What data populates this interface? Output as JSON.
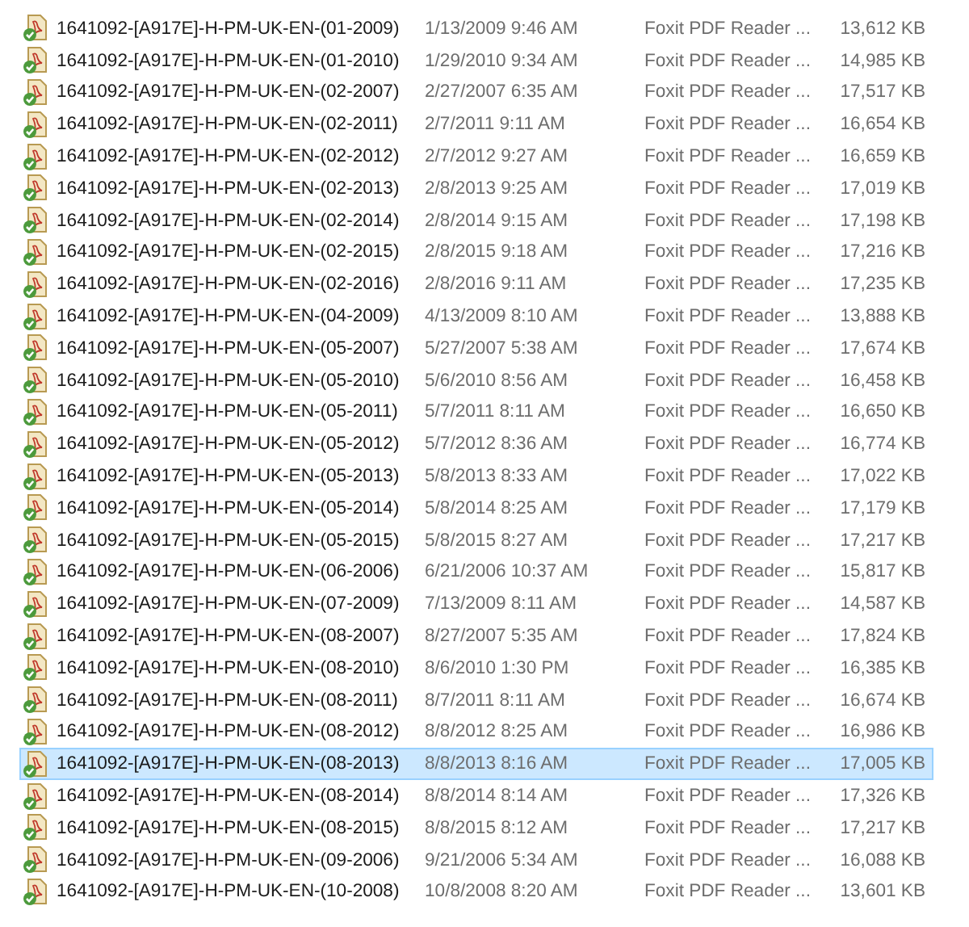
{
  "files": [
    {
      "name": "1641092-[A917E]-H-PM-UK-EN-(01-2009)",
      "date": "1/13/2009 9:46 AM",
      "type": "Foxit PDF Reader ...",
      "size": "13,612 KB",
      "selected": false
    },
    {
      "name": "1641092-[A917E]-H-PM-UK-EN-(01-2010)",
      "date": "1/29/2010 9:34 AM",
      "type": "Foxit PDF Reader ...",
      "size": "14,985 KB",
      "selected": false
    },
    {
      "name": "1641092-[A917E]-H-PM-UK-EN-(02-2007)",
      "date": "2/27/2007 6:35 AM",
      "type": "Foxit PDF Reader ...",
      "size": "17,517 KB",
      "selected": false
    },
    {
      "name": "1641092-[A917E]-H-PM-UK-EN-(02-2011)",
      "date": "2/7/2011 9:11 AM",
      "type": "Foxit PDF Reader ...",
      "size": "16,654 KB",
      "selected": false
    },
    {
      "name": "1641092-[A917E]-H-PM-UK-EN-(02-2012)",
      "date": "2/7/2012 9:27 AM",
      "type": "Foxit PDF Reader ...",
      "size": "16,659 KB",
      "selected": false
    },
    {
      "name": "1641092-[A917E]-H-PM-UK-EN-(02-2013)",
      "date": "2/8/2013 9:25 AM",
      "type": "Foxit PDF Reader ...",
      "size": "17,019 KB",
      "selected": false
    },
    {
      "name": "1641092-[A917E]-H-PM-UK-EN-(02-2014)",
      "date": "2/8/2014 9:15 AM",
      "type": "Foxit PDF Reader ...",
      "size": "17,198 KB",
      "selected": false
    },
    {
      "name": "1641092-[A917E]-H-PM-UK-EN-(02-2015)",
      "date": "2/8/2015 9:18 AM",
      "type": "Foxit PDF Reader ...",
      "size": "17,216 KB",
      "selected": false
    },
    {
      "name": "1641092-[A917E]-H-PM-UK-EN-(02-2016)",
      "date": "2/8/2016 9:11 AM",
      "type": "Foxit PDF Reader ...",
      "size": "17,235 KB",
      "selected": false
    },
    {
      "name": "1641092-[A917E]-H-PM-UK-EN-(04-2009)",
      "date": "4/13/2009 8:10 AM",
      "type": "Foxit PDF Reader ...",
      "size": "13,888 KB",
      "selected": false
    },
    {
      "name": "1641092-[A917E]-H-PM-UK-EN-(05-2007)",
      "date": "5/27/2007 5:38 AM",
      "type": "Foxit PDF Reader ...",
      "size": "17,674 KB",
      "selected": false
    },
    {
      "name": "1641092-[A917E]-H-PM-UK-EN-(05-2010)",
      "date": "5/6/2010 8:56 AM",
      "type": "Foxit PDF Reader ...",
      "size": "16,458 KB",
      "selected": false
    },
    {
      "name": "1641092-[A917E]-H-PM-UK-EN-(05-2011)",
      "date": "5/7/2011 8:11 AM",
      "type": "Foxit PDF Reader ...",
      "size": "16,650 KB",
      "selected": false
    },
    {
      "name": "1641092-[A917E]-H-PM-UK-EN-(05-2012)",
      "date": "5/7/2012 8:36 AM",
      "type": "Foxit PDF Reader ...",
      "size": "16,774 KB",
      "selected": false
    },
    {
      "name": "1641092-[A917E]-H-PM-UK-EN-(05-2013)",
      "date": "5/8/2013 8:33 AM",
      "type": "Foxit PDF Reader ...",
      "size": "17,022 KB",
      "selected": false
    },
    {
      "name": "1641092-[A917E]-H-PM-UK-EN-(05-2014)",
      "date": "5/8/2014 8:25 AM",
      "type": "Foxit PDF Reader ...",
      "size": "17,179 KB",
      "selected": false
    },
    {
      "name": "1641092-[A917E]-H-PM-UK-EN-(05-2015)",
      "date": "5/8/2015 8:27 AM",
      "type": "Foxit PDF Reader ...",
      "size": "17,217 KB",
      "selected": false
    },
    {
      "name": "1641092-[A917E]-H-PM-UK-EN-(06-2006)",
      "date": "6/21/2006 10:37 AM",
      "type": "Foxit PDF Reader ...",
      "size": "15,817 KB",
      "selected": false
    },
    {
      "name": "1641092-[A917E]-H-PM-UK-EN-(07-2009)",
      "date": "7/13/2009 8:11 AM",
      "type": "Foxit PDF Reader ...",
      "size": "14,587 KB",
      "selected": false
    },
    {
      "name": "1641092-[A917E]-H-PM-UK-EN-(08-2007)",
      "date": "8/27/2007 5:35 AM",
      "type": "Foxit PDF Reader ...",
      "size": "17,824 KB",
      "selected": false
    },
    {
      "name": "1641092-[A917E]-H-PM-UK-EN-(08-2010)",
      "date": "8/6/2010 1:30 PM",
      "type": "Foxit PDF Reader ...",
      "size": "16,385 KB",
      "selected": false
    },
    {
      "name": "1641092-[A917E]-H-PM-UK-EN-(08-2011)",
      "date": "8/7/2011 8:11 AM",
      "type": "Foxit PDF Reader ...",
      "size": "16,674 KB",
      "selected": false
    },
    {
      "name": "1641092-[A917E]-H-PM-UK-EN-(08-2012)",
      "date": "8/8/2012 8:25 AM",
      "type": "Foxit PDF Reader ...",
      "size": "16,986 KB",
      "selected": false
    },
    {
      "name": "1641092-[A917E]-H-PM-UK-EN-(08-2013)",
      "date": "8/8/2013 8:16 AM",
      "type": "Foxit PDF Reader ...",
      "size": "17,005 KB",
      "selected": true
    },
    {
      "name": "1641092-[A917E]-H-PM-UK-EN-(08-2014)",
      "date": "8/8/2014 8:14 AM",
      "type": "Foxit PDF Reader ...",
      "size": "17,326 KB",
      "selected": false
    },
    {
      "name": "1641092-[A917E]-H-PM-UK-EN-(08-2015)",
      "date": "8/8/2015 8:12 AM",
      "type": "Foxit PDF Reader ...",
      "size": "17,217 KB",
      "selected": false
    },
    {
      "name": "1641092-[A917E]-H-PM-UK-EN-(09-2006)",
      "date": "9/21/2006 5:34 AM",
      "type": "Foxit PDF Reader ...",
      "size": "16,088 KB",
      "selected": false
    },
    {
      "name": "1641092-[A917E]-H-PM-UK-EN-(10-2008)",
      "date": "10/8/2008 8:20 AM",
      "type": "Foxit PDF Reader ...",
      "size": "13,601 KB",
      "selected": false
    }
  ]
}
